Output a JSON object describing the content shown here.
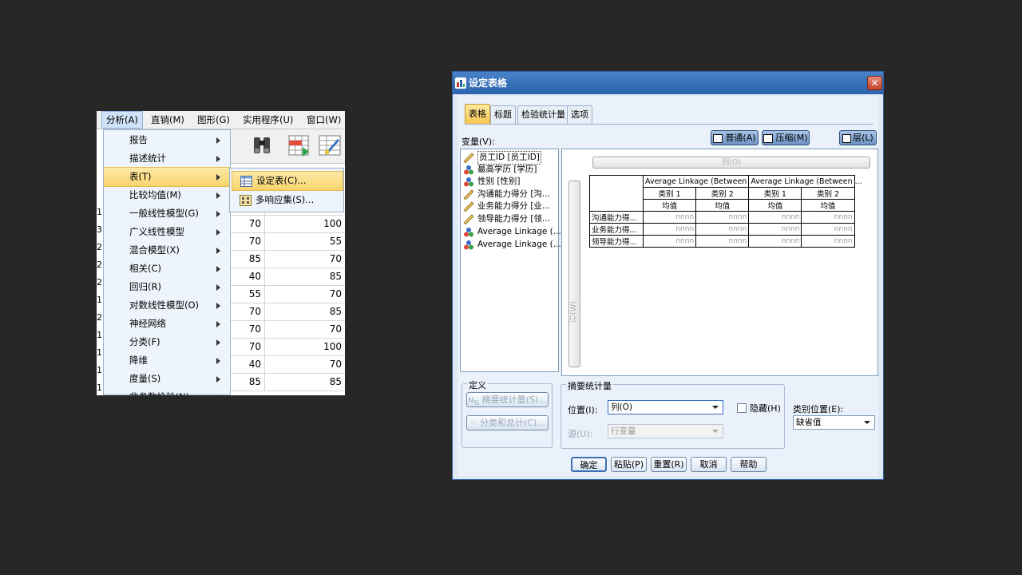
{
  "spss_window": {
    "menubar": [
      "分析(A)",
      "直销(M)",
      "图形(G)",
      "实用程序(U)",
      "窗口(W)"
    ],
    "analyze_menu": [
      {
        "label": "报告",
        "submenu": true
      },
      {
        "label": "描述统计",
        "submenu": true
      },
      {
        "label": "表(T)",
        "submenu": true,
        "highlighted": true
      },
      {
        "label": "比较均值(M)",
        "submenu": true
      },
      {
        "label": "一般线性模型(G)",
        "submenu": true
      },
      {
        "label": "广义线性模型",
        "submenu": true
      },
      {
        "label": "混合模型(X)",
        "submenu": true
      },
      {
        "label": "相关(C)",
        "submenu": true
      },
      {
        "label": "回归(R)",
        "submenu": true
      },
      {
        "label": "对数线性模型(O)",
        "submenu": true
      },
      {
        "label": "神经网络",
        "submenu": true
      },
      {
        "label": "分类(F)",
        "submenu": true
      },
      {
        "label": "降维",
        "submenu": true
      },
      {
        "label": "度量(S)",
        "submenu": true
      },
      {
        "label": "非参数检验(N)",
        "submenu": true
      }
    ],
    "tables_submenu": [
      {
        "label": "设定表(C)...",
        "icon": "custom-tables-icon",
        "highlighted": true
      },
      {
        "label": "多响应集(S)...",
        "icon": "multiple-response-icon"
      }
    ],
    "toolbar_icons": [
      "binoculars-icon",
      "insert-cases-icon",
      "select-cases-icon"
    ],
    "data_rows": [
      {
        "row_no": "",
        "a": "",
        "b": ""
      },
      {
        "row_no": "1",
        "a": "70",
        "b": "100"
      },
      {
        "row_no": "2",
        "a": "70",
        "b": "55"
      },
      {
        "row_no": "2",
        "a": "85",
        "b": "70"
      },
      {
        "row_no": "2",
        "a": "40",
        "b": "85"
      },
      {
        "row_no": "1",
        "a": "55",
        "b": "70"
      },
      {
        "row_no": "2",
        "a": "70",
        "b": "85"
      },
      {
        "row_no": "1",
        "a": "70",
        "b": "70"
      },
      {
        "row_no": "1",
        "a": "70",
        "b": "100"
      },
      {
        "row_no": "1",
        "a": "40",
        "b": "70"
      },
      {
        "row_no": "1",
        "a": "85",
        "b": "85"
      }
    ],
    "row_numbers_visible": [
      "1",
      "3",
      "2",
      "2",
      "2",
      "1",
      "2",
      "1",
      "1",
      "1",
      "1"
    ]
  },
  "dialog": {
    "title": "设定表格",
    "close": "✕",
    "tabs": [
      "表格",
      "标题",
      "检验统计量",
      "选项"
    ],
    "variables_label": "变量(V):",
    "view_buttons": {
      "normal": "普通(A)",
      "compact": "压缩(M)",
      "layers": "层(L)"
    },
    "variables": [
      {
        "label": "员工ID [员工ID]",
        "type": "scale",
        "selected": true
      },
      {
        "label": "最高学历 [学历]",
        "type": "nominal"
      },
      {
        "label": "性别 [性别]",
        "type": "nominal"
      },
      {
        "label": "沟通能力得分 [沟...",
        "type": "scale"
      },
      {
        "label": "业务能力得分 [业...",
        "type": "scale"
      },
      {
        "label": "领导能力得分 [领...",
        "type": "scale"
      },
      {
        "label": "Average Linkage (...",
        "type": "nominal"
      },
      {
        "label": "Average Linkage (...",
        "type": "nominal"
      }
    ],
    "canvas": {
      "columns_drop": "列(O)",
      "rows_drop": "行(W)",
      "table": {
        "group_headers": [
          "Average Linkage (Between",
          "Average Linkage (Between",
          "..."
        ],
        "category_headers": [
          "类别 1",
          "类别 2",
          "类别 1",
          "类别 2"
        ],
        "stat_headers": [
          "均值",
          "均值",
          "均值",
          "均值"
        ],
        "rows": [
          {
            "label": "沟通能力得...",
            "cells": [
              "nnnn",
              "nnnn",
              "nnnn",
              "nnnn"
            ]
          },
          {
            "label": "业务能力得...",
            "cells": [
              "nnnn",
              "nnnn",
              "nnnn",
              "nnnn"
            ]
          },
          {
            "label": "领导能力得...",
            "cells": [
              "nnnn",
              "nnnn",
              "nnnn",
              "nnnn"
            ]
          }
        ]
      }
    },
    "define_group": {
      "label": "定义",
      "summary_stats_button": "摘要统计量(S)...",
      "categories_totals_button": "分类和总计(C)..."
    },
    "summary_group": {
      "label": "摘要统计量",
      "position_label": "位置(I):",
      "position_value": "列(O)",
      "hide_label": "隐藏(H)",
      "source_label": "源(U):",
      "source_value": "行变量"
    },
    "category_position": {
      "label": "类别位置(E):",
      "value": "缺省值"
    },
    "bottom_buttons": [
      "确定",
      "粘贴(P)",
      "重置(R)",
      "取消",
      "帮助"
    ]
  },
  "colors": {
    "background": "#272727",
    "title_bar": "#2b63ad",
    "highlight": "#f8d46c"
  }
}
